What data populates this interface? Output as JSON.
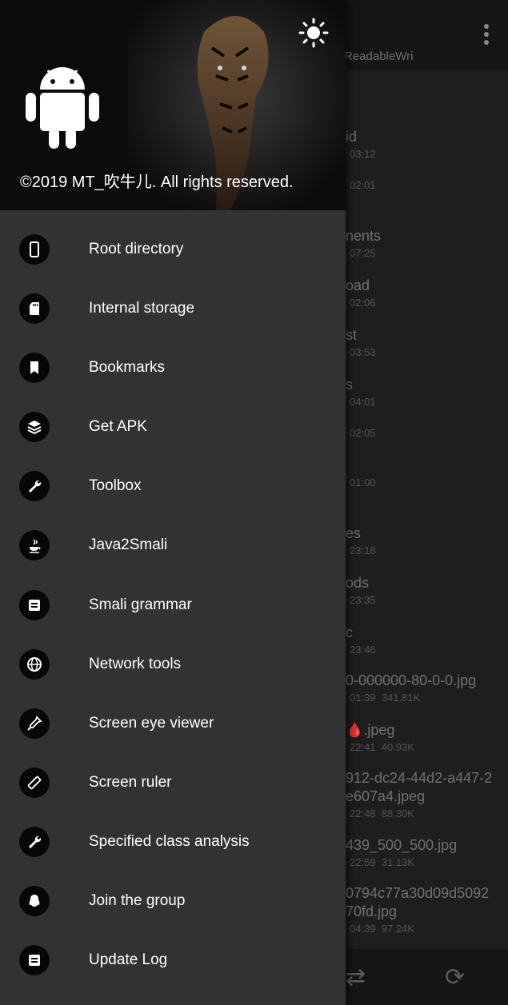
{
  "header": {
    "copyright": "©2019 MT_吹牛儿. All rights reserved."
  },
  "menu": [
    {
      "label": "Root directory",
      "icon": "phone-icon"
    },
    {
      "label": "Internal storage",
      "icon": "sd-card-icon"
    },
    {
      "label": "Bookmarks",
      "icon": "bookmark-icon"
    },
    {
      "label": "Get APK",
      "icon": "layers-icon"
    },
    {
      "label": "Toolbox",
      "icon": "wrench-icon"
    },
    {
      "label": "Java2Smali",
      "icon": "java-icon"
    },
    {
      "label": "Smali grammar",
      "icon": "book-icon"
    },
    {
      "label": "Network tools",
      "icon": "globe-icon"
    },
    {
      "label": "Screen eye viewer",
      "icon": "eyedropper-icon"
    },
    {
      "label": "Screen ruler",
      "icon": "ruler-icon"
    },
    {
      "label": "Specified class analysis",
      "icon": "wrench-icon"
    },
    {
      "label": "Join the group",
      "icon": "qq-penguin-icon"
    },
    {
      "label": "Update Log",
      "icon": "book-icon"
    }
  ],
  "background": {
    "path": "ReadableWri",
    "items": [
      {
        "name": "id",
        "meta": "03:12"
      },
      {
        "name": "",
        "meta": "02:01"
      },
      {
        "name": "nents",
        "meta": "07:25"
      },
      {
        "name": "oad",
        "meta": "02:06"
      },
      {
        "name": "st",
        "meta": "03:53"
      },
      {
        "name": "s",
        "meta": "04:01"
      },
      {
        "name": "",
        "meta": "02:05"
      },
      {
        "name": "",
        "meta": "01:00"
      },
      {
        "name": "es",
        "meta": "23:18"
      },
      {
        "name": "ods",
        "meta": "23:35"
      },
      {
        "name": "c",
        "meta": "23:46"
      },
      {
        "name": "0-000000-80-0-0.jpg",
        "meta": "01:39  341.81K"
      },
      {
        "name": "🩸.jpeg",
        "meta": "22:41  40.93K"
      },
      {
        "name": "912-dc24-44d2-a447-2\ne607a4.jpeg",
        "meta": "22:48  88.30K"
      },
      {
        "name": "439_500_500.jpg",
        "meta": "22:59  31.13K"
      },
      {
        "name": "0794c77a30d09d5092\n70fd.jpg",
        "meta": "04:39  97.24K"
      }
    ]
  }
}
